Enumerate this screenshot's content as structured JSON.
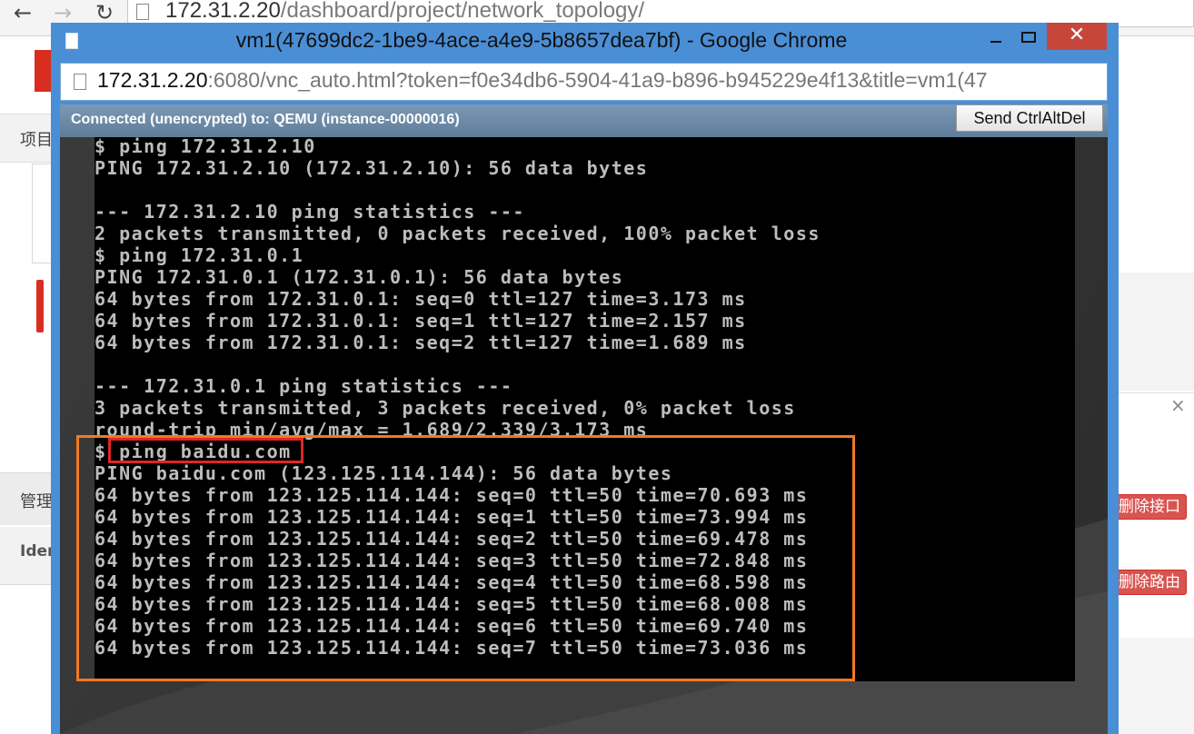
{
  "background_browser": {
    "url_host": "172.31.2.20",
    "url_path": "/dashboard/project/network_topology/",
    "nav_items": [
      "项目",
      "管理",
      "Ider"
    ],
    "right_buttons": [
      "删除接口",
      "删除路由"
    ],
    "close_glyph": "×"
  },
  "popup": {
    "title": "vm1(47699dc2-1be9-4ace-a4e9-5b8657dea7bf) - Google Chrome",
    "url_host": "172.31.2.20",
    "url_rest": ":6080/vnc_auto.html?token=f0e34db6-5904-41a9-b896-b945229e4f13&title=vm1(47",
    "close_glyph": "✕",
    "vnc": {
      "status": "Connected (unencrypted) to: QEMU (instance-00000016)",
      "send_button": "Send CtrlAltDel"
    }
  },
  "terminal": {
    "lines": [
      "$ ping 172.31.2.10",
      "PING 172.31.2.10 (172.31.2.10): 56 data bytes",
      "",
      "--- 172.31.2.10 ping statistics ---",
      "2 packets transmitted, 0 packets received, 100% packet loss",
      "$ ping 172.31.0.1",
      "PING 172.31.0.1 (172.31.0.1): 56 data bytes",
      "64 bytes from 172.31.0.1: seq=0 ttl=127 time=3.173 ms",
      "64 bytes from 172.31.0.1: seq=1 ttl=127 time=2.157 ms",
      "64 bytes from 172.31.0.1: seq=2 ttl=127 time=1.689 ms",
      "",
      "--- 172.31.0.1 ping statistics ---",
      "3 packets transmitted, 3 packets received, 0% packet loss",
      "round-trip min/avg/max = 1.689/2.339/3.173 ms",
      "$ ping baidu.com",
      "PING baidu.com (123.125.114.144): 56 data bytes",
      "64 bytes from 123.125.114.144: seq=0 ttl=50 time=70.693 ms",
      "64 bytes from 123.125.114.144: seq=1 ttl=50 time=73.994 ms",
      "64 bytes from 123.125.114.144: seq=2 ttl=50 time=69.478 ms",
      "64 bytes from 123.125.114.144: seq=3 ttl=50 time=72.848 ms",
      "64 bytes from 123.125.114.144: seq=4 ttl=50 time=68.598 ms",
      "64 bytes from 123.125.114.144: seq=5 ttl=50 time=68.008 ms",
      "64 bytes from 123.125.114.144: seq=6 ttl=50 time=69.740 ms",
      "64 bytes from 123.125.114.144: seq=7 ttl=50 time=73.036 ms"
    ]
  },
  "colors": {
    "popup_frame": "#4a8ed6",
    "close_button": "#c7463c",
    "terminal_bg": "#000000",
    "terminal_text": "#bdbdbd",
    "highlight_orange": "#f07a23",
    "highlight_red": "#e02525"
  }
}
